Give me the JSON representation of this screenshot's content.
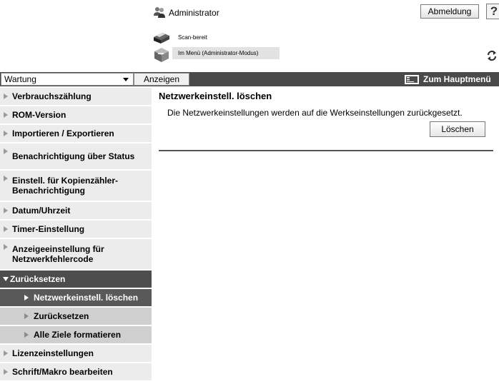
{
  "header": {
    "user_name": "Administrator",
    "logout_label": "Abmeldung",
    "help_label": "?",
    "status_scan": "Scan-bereit",
    "status_mode": "Im Menü (Administrator-Modus)"
  },
  "toolbar": {
    "select_value": "Wartung",
    "display_label": "Anzeigen",
    "home_label": "Zum Hauptmenü"
  },
  "sidebar": {
    "items": [
      {
        "label": "Verbrauchszählung"
      },
      {
        "label": "ROM-Version"
      },
      {
        "label": "Importieren / Exportieren"
      },
      {
        "label": "Benachrichtigung über Status"
      },
      {
        "label": "Einstell. für Kopienzähler-Benachrichtigung"
      },
      {
        "label": "Datum/Uhrzeit"
      },
      {
        "label": "Timer-Einstellung"
      },
      {
        "label": "Anzeigeeinstellung für Netzwerkfehlercode"
      },
      {
        "label": "Zurücksetzen"
      },
      {
        "label": "Netzwerkeinstell. löschen"
      },
      {
        "label": "Zurücksetzen"
      },
      {
        "label": "Alle Ziele formatieren"
      },
      {
        "label": "Lizenzeinstellungen"
      },
      {
        "label": "Schrift/Makro bearbeiten"
      }
    ]
  },
  "main": {
    "title": "Netzwerkeinstell. löschen",
    "description": "Die Netzwerkeinstellungen werden auf die Werkseinstellungen zurückgesetzt.",
    "reset_button": "Löschen"
  },
  "colors": {
    "toolbar_bg": "#4a4a4a",
    "nav_bg": "#ececec",
    "nav_open_bg": "#4d4d4d",
    "nav_sub_bg": "#cfcfcf",
    "nav_active_bg": "#595959"
  },
  "icons": {
    "user": "user-group-icon",
    "printer": "printer-icon",
    "device": "device-box-icon",
    "refresh": "refresh-icon",
    "home": "home-screen-icon"
  }
}
